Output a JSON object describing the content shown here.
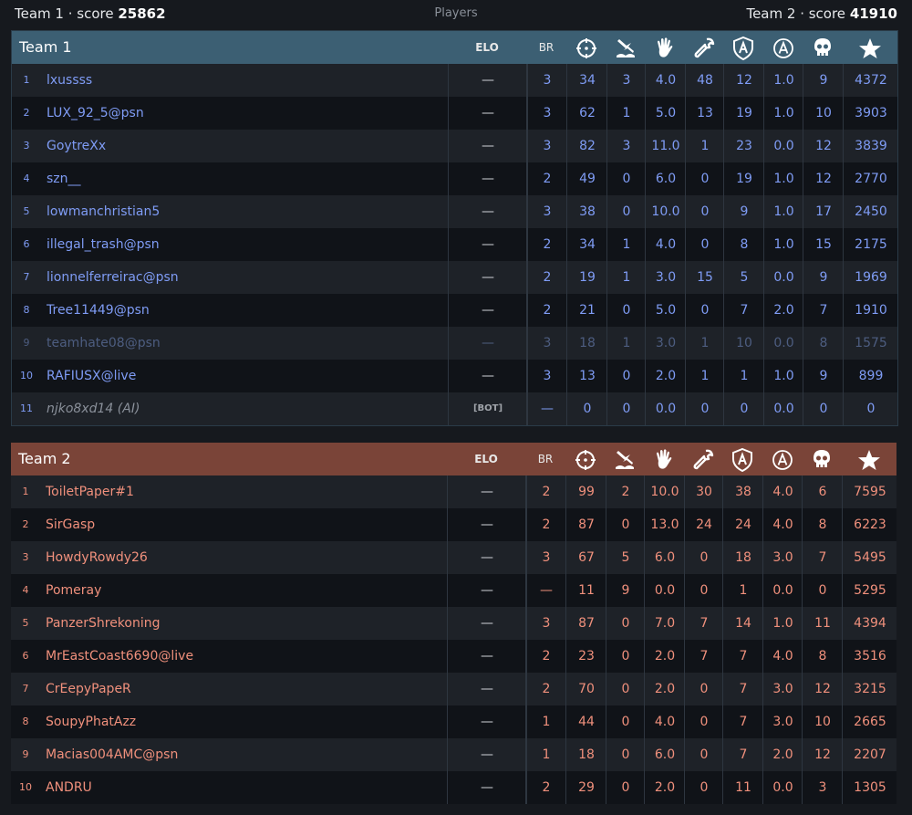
{
  "header": {
    "team1_label": "Team 1 · score ",
    "team1_score": "25862",
    "center_label": "Players",
    "team2_label": "Team 2 · score ",
    "team2_score": "41910"
  },
  "columns": {
    "elo": "ELO",
    "br": "BR",
    "icons": [
      "crosshair-icon",
      "plane-crash-icon",
      "hand-wave-icon",
      "wrench-icon",
      "shield-a-icon",
      "circle-a-icon",
      "skull-icon",
      "star-icon"
    ]
  },
  "team1": {
    "title": "Team 1",
    "rows": [
      {
        "n": "1",
        "name": "lxussss",
        "elo": "—",
        "br": "3",
        "s": [
          "34",
          "3",
          "4.0",
          "48",
          "12",
          "1.0",
          "9",
          "4372"
        ]
      },
      {
        "n": "2",
        "name": "LUX_92_5@psn",
        "elo": "—",
        "br": "3",
        "s": [
          "62",
          "1",
          "5.0",
          "13",
          "19",
          "1.0",
          "10",
          "3903"
        ]
      },
      {
        "n": "3",
        "name": "GoytreXx",
        "elo": "—",
        "br": "3",
        "s": [
          "82",
          "3",
          "11.0",
          "1",
          "23",
          "0.0",
          "12",
          "3839"
        ]
      },
      {
        "n": "4",
        "name": "szn__",
        "elo": "—",
        "br": "2",
        "s": [
          "49",
          "0",
          "6.0",
          "0",
          "19",
          "1.0",
          "12",
          "2770"
        ]
      },
      {
        "n": "5",
        "name": "lowmanchristian5",
        "elo": "—",
        "br": "3",
        "s": [
          "38",
          "0",
          "10.0",
          "0",
          "9",
          "1.0",
          "17",
          "2450"
        ]
      },
      {
        "n": "6",
        "name": "illegal_trash@psn",
        "elo": "—",
        "br": "2",
        "s": [
          "34",
          "1",
          "4.0",
          "0",
          "8",
          "1.0",
          "15",
          "2175"
        ]
      },
      {
        "n": "7",
        "name": "lionnelferreirac@psn",
        "elo": "—",
        "br": "2",
        "s": [
          "19",
          "1",
          "3.0",
          "15",
          "5",
          "0.0",
          "9",
          "1969"
        ]
      },
      {
        "n": "8",
        "name": "Tree11449@psn",
        "elo": "—",
        "br": "2",
        "s": [
          "21",
          "0",
          "5.0",
          "0",
          "7",
          "2.0",
          "7",
          "1910"
        ]
      },
      {
        "n": "9",
        "name": "teamhate08@psn",
        "elo": "—",
        "br": "3",
        "s": [
          "18",
          "1",
          "3.0",
          "1",
          "10",
          "0.0",
          "8",
          "1575"
        ]
      },
      {
        "n": "10",
        "name": "RAFIUSX@live",
        "elo": "—",
        "br": "3",
        "s": [
          "13",
          "0",
          "2.0",
          "1",
          "1",
          "1.0",
          "9",
          "899"
        ]
      },
      {
        "n": "11",
        "name": "njko8xd14 (AI)",
        "elo": "[BOT]",
        "br": "—",
        "s": [
          "0",
          "0",
          "0.0",
          "0",
          "0",
          "0.0",
          "0",
          "0"
        ]
      }
    ]
  },
  "team2": {
    "title": "Team 2",
    "rows": [
      {
        "n": "1",
        "name": "ToiletPaper#1",
        "elo": "—",
        "br": "2",
        "s": [
          "99",
          "2",
          "10.0",
          "30",
          "38",
          "4.0",
          "6",
          "7595"
        ]
      },
      {
        "n": "2",
        "name": "SirGasp",
        "elo": "—",
        "br": "2",
        "s": [
          "87",
          "0",
          "13.0",
          "24",
          "24",
          "4.0",
          "8",
          "6223"
        ]
      },
      {
        "n": "3",
        "name": "HowdyRowdy26",
        "elo": "—",
        "br": "3",
        "s": [
          "67",
          "5",
          "6.0",
          "0",
          "18",
          "3.0",
          "7",
          "5495"
        ]
      },
      {
        "n": "4",
        "name": "Pomeray",
        "elo": "—",
        "br": "—",
        "s": [
          "11",
          "9",
          "0.0",
          "0",
          "1",
          "0.0",
          "0",
          "5295"
        ]
      },
      {
        "n": "5",
        "name": "PanzerShrekoning",
        "elo": "—",
        "br": "3",
        "s": [
          "87",
          "0",
          "7.0",
          "7",
          "14",
          "1.0",
          "11",
          "4394"
        ]
      },
      {
        "n": "6",
        "name": "MrEastCoast6690@live",
        "elo": "—",
        "br": "2",
        "s": [
          "23",
          "0",
          "2.0",
          "7",
          "7",
          "4.0",
          "8",
          "3516"
        ]
      },
      {
        "n": "7",
        "name": "CrEepyPapeR",
        "elo": "—",
        "br": "2",
        "s": [
          "70",
          "0",
          "2.0",
          "0",
          "7",
          "3.0",
          "12",
          "3215"
        ]
      },
      {
        "n": "8",
        "name": "SoupyPhatAzz",
        "elo": "—",
        "br": "1",
        "s": [
          "44",
          "0",
          "4.0",
          "0",
          "7",
          "3.0",
          "10",
          "2665"
        ]
      },
      {
        "n": "9",
        "name": "Macias004AMC@psn",
        "elo": "—",
        "br": "1",
        "s": [
          "18",
          "0",
          "6.0",
          "0",
          "7",
          "2.0",
          "12",
          "2207"
        ]
      },
      {
        "n": "10",
        "name": "ANDRU",
        "elo": "—",
        "br": "2",
        "s": [
          "29",
          "0",
          "2.0",
          "0",
          "11",
          "0.0",
          "3",
          "1305"
        ]
      }
    ]
  },
  "colors": {
    "team1_header": "#3c5f73",
    "team2_header": "#7a4438",
    "team1_text": "#7f9cf5",
    "team2_text": "#f0907c"
  }
}
